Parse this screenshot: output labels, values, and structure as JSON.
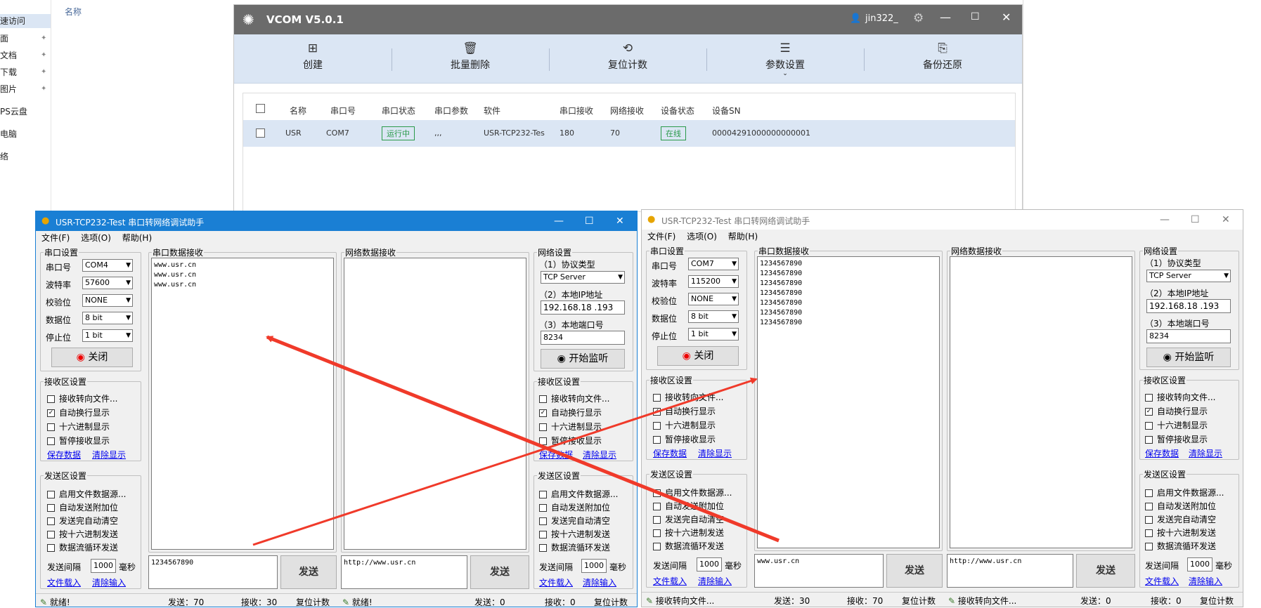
{
  "explorer": {
    "header": "名称",
    "items": [
      "速访问",
      "面",
      "文档",
      "下载",
      "图片",
      "PS云盘",
      "电脑",
      "络"
    ]
  },
  "vcom": {
    "title": "VCOM V5.0.1",
    "user": "jin322_",
    "toolbar": [
      {
        "label": "创建",
        "icon": "⊞"
      },
      {
        "label": "批量删除",
        "icon": "🗑"
      },
      {
        "label": "复位计数",
        "icon": "⟲"
      },
      {
        "label": "参数设置",
        "icon": "☰"
      },
      {
        "label": "备份还原",
        "icon": "⎘"
      }
    ],
    "columns": [
      "名称",
      "串口号",
      "串口状态",
      "串口参数",
      "软件",
      "串口接收",
      "网络接收",
      "设备状态",
      "设备SN"
    ],
    "row": {
      "name": "USR",
      "port": "COM7",
      "port_status": "运行中",
      "port_params": ",,,",
      "software": "USR-TCP232-Tes",
      "serial_rx": "180",
      "net_rx": "70",
      "device_status": "在线",
      "sn": "00004291000000000001"
    }
  },
  "tool_left": {
    "title": "USR-TCP232-Test 串口转网络调试助手",
    "menu": [
      "文件(F)",
      "选项(O)",
      "帮助(H)"
    ],
    "serial_settings": "串口设置",
    "port_label": "串口号",
    "port": "COM4",
    "baud_label": "波特率",
    "baud": "57600",
    "parity_label": "校验位",
    "parity": "NONE",
    "data_label": "数据位",
    "data": "8 bit",
    "stop_label": "停止位",
    "stop": "1 bit",
    "close_btn": "关闭",
    "serial_rx_title": "串口数据接收",
    "serial_rx_text": "www.usr.cn\nwww.usr.cn\nwww.usr.cn",
    "net_rx_title": "网络数据接收",
    "net_rx_text": "",
    "net_settings": "网络设置",
    "proto_label": "（1）协议类型",
    "proto": "TCP Server",
    "ip_label": "（2）本地IP地址",
    "ip": "192.168.18 .193",
    "localport_label": "（3）本地端口号",
    "localport": "8234",
    "listen_btn": "开始监听",
    "rx_settings": "接收区设置",
    "rx_opts": [
      {
        "t": "接收转向文件...",
        "c": false
      },
      {
        "t": "自动换行显示",
        "c": true
      },
      {
        "t": "十六进制显示",
        "c": false
      },
      {
        "t": "暂停接收显示",
        "c": false
      }
    ],
    "save_data": "保存数据",
    "clear_display": "清除显示",
    "tx_settings": "发送区设置",
    "tx_opts": [
      "启用文件数据源...",
      "自动发送附加位",
      "发送完自动清空",
      "按十六进制发送",
      "数据流循环发送"
    ],
    "interval_label": "发送间隔",
    "interval": "1000",
    "ms": "毫秒",
    "load_file": "文件载入",
    "clear_input": "清除输入",
    "serial_tx_text": "1234567890",
    "net_tx_text": "http://www.usr.cn",
    "send_btn": "发送",
    "status_left": "就绪!",
    "sent": "发送：70",
    "recv": "接收：30",
    "reset": "复位计数",
    "status_mid": "就绪!",
    "sent2": "发送：0",
    "recv2": "接收：0",
    "reset2": "复位计数"
  },
  "tool_right": {
    "title": "USR-TCP232-Test 串口转网络调试助手",
    "menu": [
      "文件(F)",
      "选项(O)",
      "帮助(H)"
    ],
    "serial_settings": "串口设置",
    "port_label": "串口号",
    "port": "COM7",
    "baud_label": "波特率",
    "baud": "115200",
    "parity_label": "校验位",
    "parity": "NONE",
    "data_label": "数据位",
    "data": "8 bit",
    "stop_label": "停止位",
    "stop": "1 bit",
    "close_btn": "关闭",
    "serial_rx_title": "串口数据接收",
    "serial_rx_text": "1234567890\n1234567890\n1234567890\n1234567890\n1234567890\n1234567890\n1234567890",
    "net_rx_title": "网络数据接收",
    "net_rx_text": "",
    "net_settings": "网络设置",
    "proto_label": "（1）协议类型",
    "proto": "TCP Server",
    "ip_label": "（2）本地IP地址",
    "ip": "192.168.18 .193",
    "localport_label": "（3）本地端口号",
    "localport": "8234",
    "listen_btn": "开始监听",
    "rx_settings": "接收区设置",
    "rx_opts": [
      {
        "t": "接收转向文件...",
        "c": false
      },
      {
        "t": "自动换行显示",
        "c": true
      },
      {
        "t": "十六进制显示",
        "c": false
      },
      {
        "t": "暂停接收显示",
        "c": false
      }
    ],
    "save_data": "保存数据",
    "clear_display": "清除显示",
    "tx_settings": "发送区设置",
    "tx_opts": [
      "启用文件数据源...",
      "自动发送附加位",
      "发送完自动清空",
      "按十六进制发送",
      "数据流循环发送"
    ],
    "interval_label": "发送间隔",
    "interval": "1000",
    "ms": "毫秒",
    "load_file": "文件载入",
    "clear_input": "清除输入",
    "serial_tx_text": "www.usr.cn",
    "net_tx_text": "http://www.usr.cn",
    "send_btn": "发送",
    "status_left": "接收转向文件...",
    "sent": "发送：30",
    "recv": "接收：70",
    "reset": "复位计数",
    "status_mid": "接收转向文件...",
    "sent2": "发送：0",
    "recv2": "接收：0",
    "reset2": "复位计数"
  },
  "colors": {
    "vcom_title": "#6b6b6b",
    "toolbar": "#dbe6f4",
    "active_title": "#1a7fd4",
    "arrow": "#f03a2a"
  }
}
